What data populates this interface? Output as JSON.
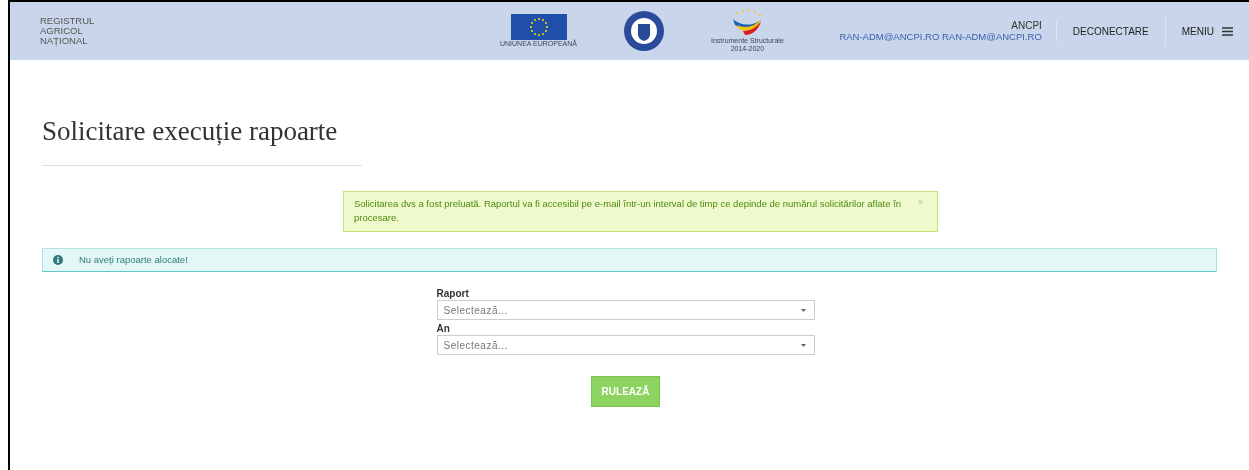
{
  "header": {
    "brand_lines": [
      "REGISTRUL",
      "AGRICOL",
      "NAȚIONAL"
    ],
    "eu_logo_caption": "UNIUNEA EUROPEANĂ",
    "structural_logo_caption": [
      "Instrumente Structurale",
      "2014-2020"
    ],
    "user": {
      "org": "ANCPI",
      "email": "RAN-ADM@ANCPI.RO RAN-ADM@ANCPI.RO"
    },
    "logout": "DECONECTARE",
    "menu": "MENIU"
  },
  "page_title": "Solicitare execuție rapoarte",
  "alerts": [
    {
      "kind": "success",
      "text": "Solicitarea dvs a fost preluată. Raportul va fi accesibil pe e-mail într-un interval de timp ce depinde de numărul solicitărilor aflate în procesare.",
      "close": "×"
    },
    {
      "kind": "info",
      "text": "Nu aveți rapoarte alocate!"
    }
  ],
  "form": {
    "fields": [
      {
        "label": "Raport",
        "placeholder": "Selectează..."
      },
      {
        "label": "An",
        "placeholder": "Selectează..."
      }
    ],
    "submit": "RULEAZĂ"
  }
}
